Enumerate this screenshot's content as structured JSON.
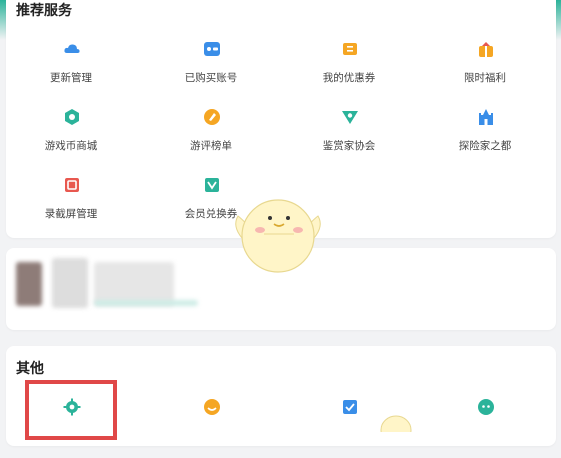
{
  "recommended": {
    "title": "推荐服务",
    "items": [
      {
        "label": "更新管理",
        "icon": "cloud-icon"
      },
      {
        "label": "已购买账号",
        "icon": "game-card-icon"
      },
      {
        "label": "我的优惠券",
        "icon": "coupon-icon"
      },
      {
        "label": "限时福利",
        "icon": "gift-icon"
      },
      {
        "label": "游戏币商城",
        "icon": "coin-shop-icon"
      },
      {
        "label": "游评榜单",
        "icon": "pen-review-icon"
      },
      {
        "label": "鉴赏家协会",
        "icon": "appraiser-icon"
      },
      {
        "label": "探险家之都",
        "icon": "castle-icon"
      },
      {
        "label": "录截屏管理",
        "icon": "record-screen-icon"
      },
      {
        "label": "会员兑换券",
        "icon": "vip-voucher-icon"
      }
    ]
  },
  "other": {
    "title": "其他",
    "items": [
      {
        "icon": "gear-icon"
      },
      {
        "icon": "smile-icon"
      },
      {
        "icon": "checklist-icon"
      },
      {
        "icon": "chat-bot-icon"
      }
    ]
  },
  "colors": {
    "accent_teal": "#2bb39a",
    "highlight_red": "#e04848",
    "icon_blue": "#3a8ee8",
    "icon_orange": "#f5a623",
    "icon_green": "#2bb39a",
    "icon_red": "#e8584f"
  }
}
